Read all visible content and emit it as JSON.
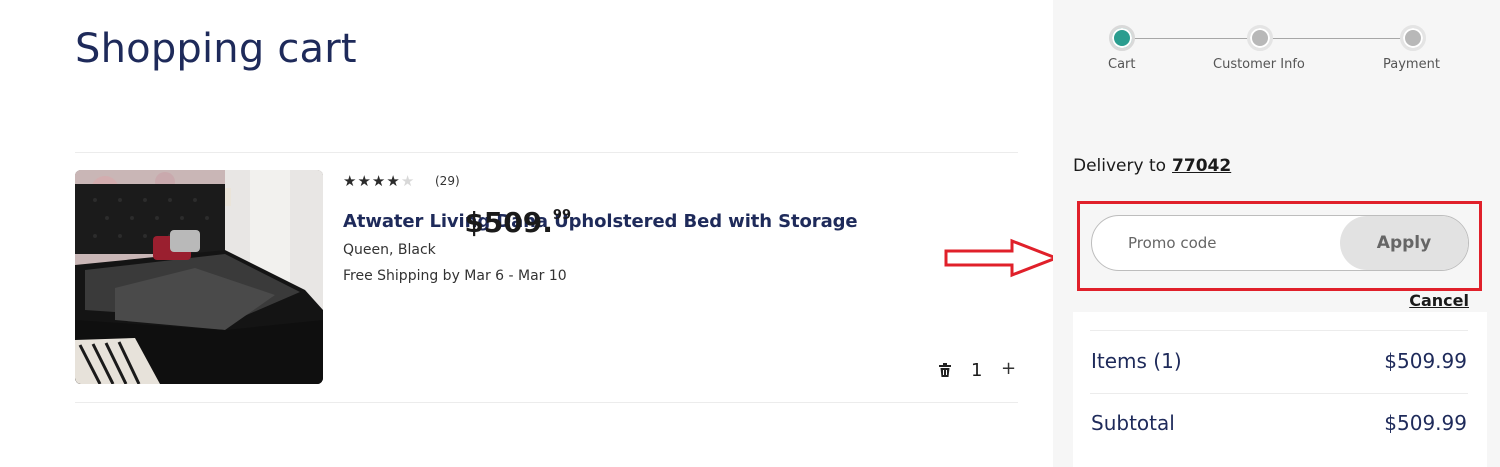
{
  "page": {
    "title": "Shopping cart"
  },
  "product": {
    "rating": 4,
    "rating_max": 5,
    "review_count": "(29)",
    "name": "Atwater Living Dana Upholstered Bed with Storage",
    "variant": "Queen, Black",
    "shipping": "Free Shipping by Mar 6 - Mar 10",
    "price_main": "$509.",
    "price_cents": "99",
    "quantity": "1",
    "plus_label": "+"
  },
  "stepper": {
    "steps": [
      {
        "label": "Cart",
        "active": true
      },
      {
        "label": "Customer Info",
        "active": false
      },
      {
        "label": "Payment",
        "active": false
      }
    ]
  },
  "delivery": {
    "prefix": "Delivery to",
    "zip": "77042"
  },
  "promo": {
    "placeholder": "Promo code",
    "apply_label": "Apply",
    "cancel_label": "Cancel"
  },
  "summary": {
    "items_label": "Items (1)",
    "items_value": "$509.99",
    "subtotal_label": "Subtotal",
    "subtotal_value": "$509.99"
  },
  "colors": {
    "accent": "#2a9d8f",
    "highlight": "#e0202a",
    "title": "#1e2a5a"
  }
}
